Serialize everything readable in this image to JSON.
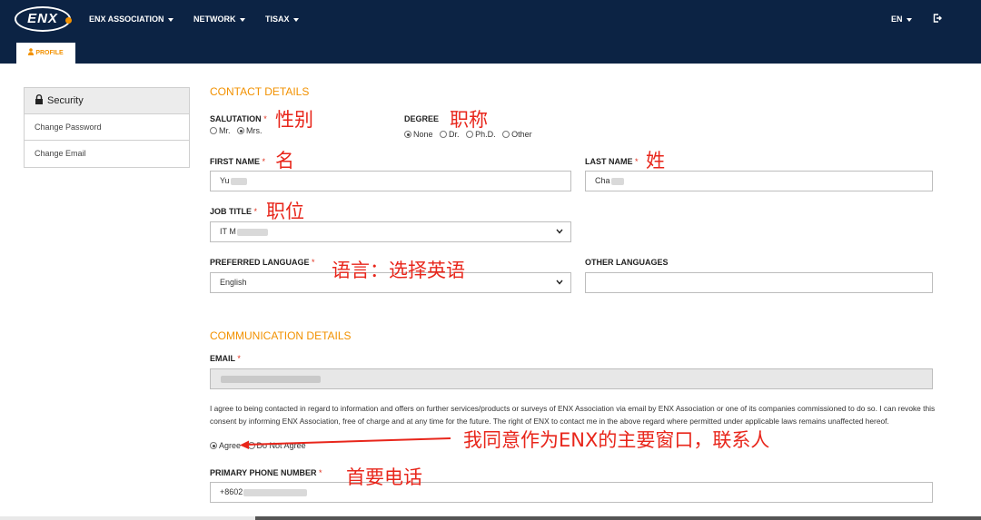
{
  "header": {
    "logo_text": "ENX",
    "nav": [
      "ENX ASSOCIATION",
      "NETWORK",
      "TISAX"
    ],
    "language": "EN",
    "active_tab": "PROFILE",
    "bg_color": "#0c2344",
    "accent_color": "#f29100"
  },
  "sidebar": {
    "heading": "Security",
    "items": [
      "Change Password",
      "Change Email"
    ]
  },
  "contact": {
    "title": "CONTACT DETAILS",
    "salutation": {
      "label": "SALUTATION",
      "options": [
        "Mr.",
        "Mrs."
      ],
      "selected": "Mrs."
    },
    "degree": {
      "label": "DEGREE",
      "options": [
        "None",
        "Dr.",
        "Ph.D.",
        "Other"
      ],
      "selected": "None"
    },
    "first_name": {
      "label": "FIRST NAME",
      "value": "Yu"
    },
    "last_name": {
      "label": "LAST NAME",
      "value": "Cha"
    },
    "job_title": {
      "label": "JOB TITLE",
      "value": "IT M"
    },
    "preferred_language": {
      "label": "PREFERRED LANGUAGE",
      "value": "English"
    },
    "other_languages": {
      "label": "OTHER LANGUAGES",
      "value": ""
    }
  },
  "communication": {
    "title": "COMMUNICATION DETAILS",
    "email": {
      "label": "EMAIL",
      "value": ""
    },
    "consent_text": "I agree to being contacted in regard to information and offers on further services/products or surveys of ENX Association via email by ENX Association or one of its companies commissioned to do so. I can revoke this consent by informing ENX Association, free of charge and at any time for the future. The right of ENX to contact me in the above regard where permitted under applicable laws remains unaffected hereof.",
    "consent_options": [
      "Agree",
      "Do Not Agree"
    ],
    "consent_selected": "Agree",
    "phone": {
      "label": "PRIMARY PHONE NUMBER",
      "value": "+8602"
    }
  },
  "annotations": {
    "salutation": "性别",
    "degree": "职称",
    "first_name": "名",
    "last_name": "姓",
    "job_title": "职位",
    "language": "语言：选择英语",
    "consent": "我同意作为ENX的主要窗口，联系人",
    "phone": "首要电话",
    "color": "#e8261b"
  },
  "icons": [
    "caret-down-icon",
    "logout-icon",
    "person-icon",
    "lock-icon",
    "chevron-down-icon"
  ]
}
